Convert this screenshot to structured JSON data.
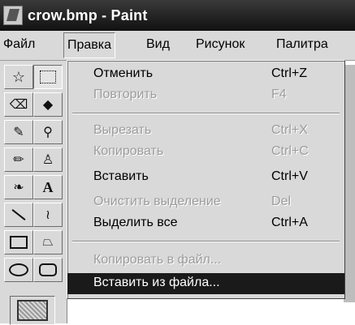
{
  "window": {
    "title": "crow.bmp - Paint"
  },
  "menubar": {
    "items": [
      {
        "label": "Файл"
      },
      {
        "label": "Правка"
      },
      {
        "label": "Вид"
      },
      {
        "label": "Рисунок"
      },
      {
        "label": "Палитра"
      }
    ]
  },
  "toolbox": {
    "icons": [
      "free-select-icon",
      "rect-select-icon",
      "eraser-icon",
      "fill-icon",
      "eyedropper-icon",
      "magnifier-icon",
      "pencil-icon",
      "brush-icon",
      "airbrush-icon",
      "text-icon",
      "line-icon",
      "curve-icon",
      "rectangle-icon",
      "polygon-icon",
      "ellipse-icon",
      "rounded-rect-icon"
    ],
    "text_tool_glyph": "A"
  },
  "edit_menu": {
    "items": [
      {
        "label": "Отменить",
        "shortcut": "Ctrl+Z",
        "enabled": true
      },
      {
        "label": "Повторить",
        "shortcut": "F4",
        "enabled": false
      },
      {
        "label": "Вырезать",
        "shortcut": "Ctrl+X",
        "enabled": false
      },
      {
        "label": "Копировать",
        "shortcut": "Ctrl+C",
        "enabled": false
      },
      {
        "label": "Вставить",
        "shortcut": "Ctrl+V",
        "enabled": true
      },
      {
        "label": "Очистить выделение",
        "shortcut": "Del",
        "enabled": false
      },
      {
        "label": "Выделить все",
        "shortcut": "Ctrl+A",
        "enabled": true
      },
      {
        "label": "Копировать в файл...",
        "shortcut": "",
        "enabled": false
      },
      {
        "label": "Вставить из файла...",
        "shortcut": "",
        "enabled": true,
        "highlighted": true
      }
    ]
  },
  "colors": {
    "highlight": "#1a1a1a",
    "face": "#d9d9d9",
    "disabled": "#9c9c9c"
  }
}
